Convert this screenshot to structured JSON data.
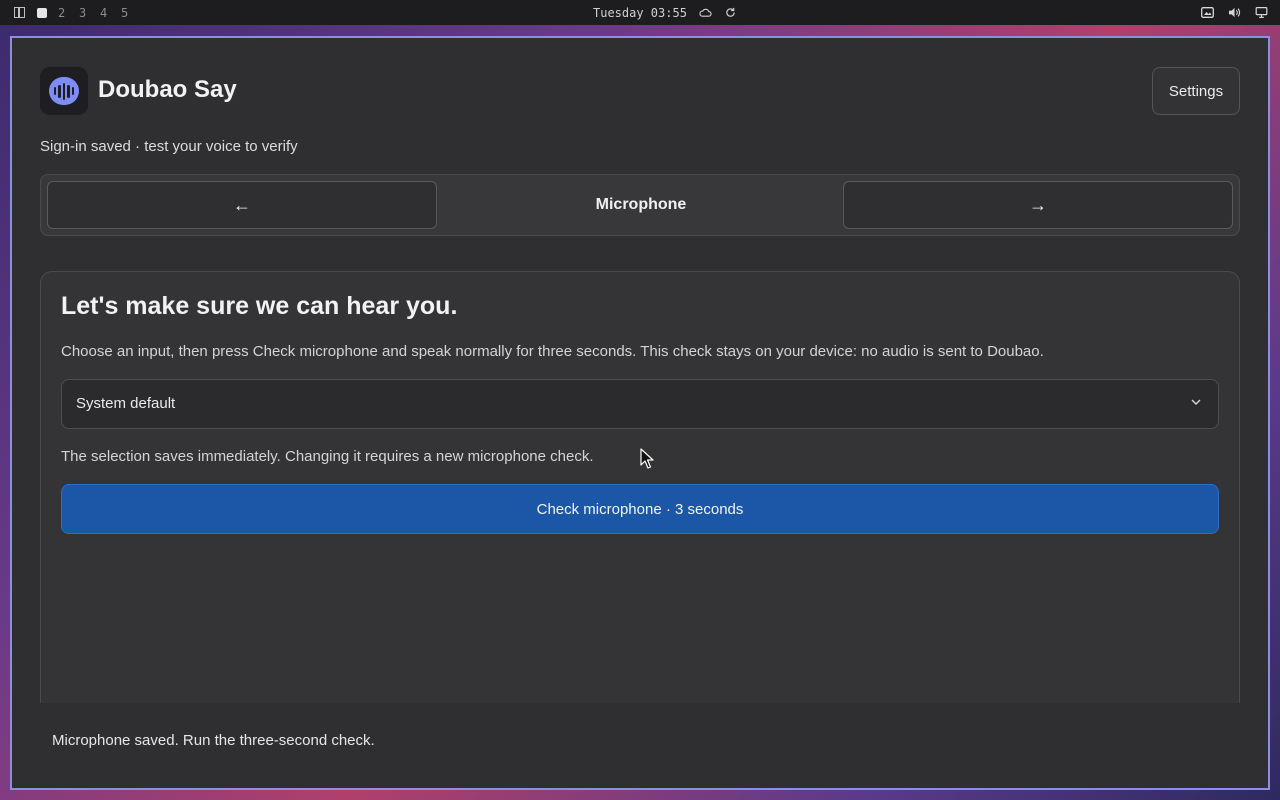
{
  "topbar": {
    "workspaces": [
      "2",
      "3",
      "4",
      "5"
    ],
    "clock": "Tuesday 03:55",
    "tray_icons": [
      "screenshot-icon",
      "volume-icon",
      "display-icon"
    ],
    "status_icons": [
      "cloud-icon",
      "sync-icon"
    ]
  },
  "app": {
    "title": "Doubao Say",
    "settings_label": "Settings",
    "subtitle": "Sign-in saved · test your voice to verify"
  },
  "nav": {
    "prev_label": "←",
    "title": "Microphone",
    "next_label": "→"
  },
  "card": {
    "heading": "Let's make sure we can hear you.",
    "description": "Choose an input, then press Check microphone and speak normally for three seconds. This check stays on your device: no audio is sent to Doubao.",
    "input_select_value": "System default",
    "note": "The selection saves immediately. Changing it requires a new microphone check.",
    "check_button_label": "Check microphone · 3 seconds"
  },
  "status": {
    "message": "Microphone saved. Run the three-second check."
  },
  "colors": {
    "accent_button": "#1b57a6",
    "window_border": "#8d8ee0",
    "app_icon": "#7d8df7"
  }
}
